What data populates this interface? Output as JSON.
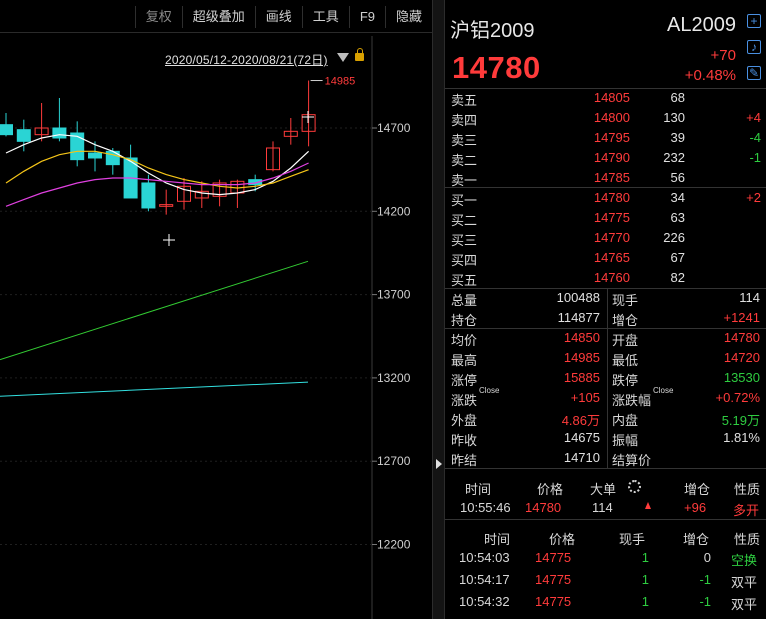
{
  "toolbar": {
    "buttons": [
      "复权",
      "超级叠加",
      "画线",
      "工具",
      "F9",
      "隐藏"
    ]
  },
  "chart": {
    "range_label": "2020/05/12-2020/08/21(72日)",
    "last_high_label": "14985",
    "y_ticks": [
      "14700",
      "14200",
      "13700",
      "13200",
      "12700",
      "12200"
    ],
    "colors": {
      "up": "#ff3b3b",
      "down": "#2ad4d4",
      "ma5": "#ffffff",
      "ma10": "#f5c518",
      "ma20": "#e040e0",
      "ma60": "#33cc33",
      "ma120": "#33e0e0"
    }
  },
  "chart_data": {
    "type": "candlestick",
    "title": "",
    "ylabel": "",
    "ylim": [
      12100,
      15050
    ],
    "series": [
      {
        "name": "",
        "ohlc": [
          [
            14720,
            14790,
            14650,
            14660
          ],
          [
            14690,
            14750,
            14560,
            14620
          ],
          [
            14660,
            14850,
            14620,
            14700
          ],
          [
            14700,
            14880,
            14620,
            14640
          ],
          [
            14670,
            14740,
            14470,
            14510
          ],
          [
            14550,
            14620,
            14440,
            14520
          ],
          [
            14560,
            14580,
            14420,
            14480
          ],
          [
            14520,
            14600,
            14280,
            14280
          ],
          [
            14370,
            14420,
            14200,
            14220
          ],
          [
            14230,
            14330,
            14180,
            14240
          ],
          [
            14260,
            14400,
            14210,
            14350
          ],
          [
            14280,
            14380,
            14220,
            14320
          ],
          [
            14290,
            14390,
            14230,
            14370
          ],
          [
            14310,
            14390,
            14220,
            14380
          ],
          [
            14390,
            14420,
            14320,
            14360
          ],
          [
            14450,
            14620,
            14440,
            14580
          ],
          [
            14650,
            14760,
            14600,
            14680
          ],
          [
            14680,
            14985,
            14590,
            14780
          ]
        ]
      },
      {
        "name": "",
        "values": [
          14550,
          14600,
          14640,
          14660,
          14650,
          14600,
          14560,
          14500,
          14430,
          14370,
          14330,
          14310,
          14300,
          14310,
          14330,
          14380,
          14460,
          14560
        ]
      },
      {
        "name": "",
        "values": [
          14370,
          14440,
          14500,
          14540,
          14560,
          14560,
          14540,
          14510,
          14460,
          14420,
          14390,
          14370,
          14350,
          14340,
          14350,
          14370,
          14410,
          14450
        ]
      },
      {
        "name": "",
        "values": [
          14230,
          14270,
          14310,
          14340,
          14370,
          14390,
          14400,
          14400,
          14390,
          14380,
          14370,
          14360,
          14360,
          14360,
          14370,
          14400,
          14440,
          14490
        ]
      },
      {
        "name": "",
        "x": [
          0,
          308
        ],
        "values": [
          13310,
          13900
        ]
      },
      {
        "name": "",
        "x": [
          0,
          308
        ],
        "values": [
          13090,
          13175
        ]
      }
    ]
  },
  "panel": {
    "contract_name": "沪铝2009",
    "contract_code": "AL2009",
    "last_price": "14780",
    "change": "+70",
    "change_pct": "+0.48%",
    "icons": [
      "add-icon",
      "bell-icon",
      "edit-icon"
    ],
    "orderbook": {
      "asks": [
        {
          "label": "卖五",
          "price": "14805",
          "vol": "68",
          "chg": "",
          "chg_dir": ""
        },
        {
          "label": "卖四",
          "price": "14800",
          "vol": "130",
          "chg": "+4",
          "chg_dir": "up"
        },
        {
          "label": "卖三",
          "price": "14795",
          "vol": "39",
          "chg": "-4",
          "chg_dir": "down"
        },
        {
          "label": "卖二",
          "price": "14790",
          "vol": "232",
          "chg": "-1",
          "chg_dir": "down"
        },
        {
          "label": "卖一",
          "price": "14785",
          "vol": "56",
          "chg": "",
          "chg_dir": ""
        }
      ],
      "bids": [
        {
          "label": "买一",
          "price": "14780",
          "vol": "34",
          "chg": "+2",
          "chg_dir": "up"
        },
        {
          "label": "买二",
          "price": "14775",
          "vol": "63",
          "chg": "",
          "chg_dir": ""
        },
        {
          "label": "买三",
          "price": "14770",
          "vol": "226",
          "chg": "",
          "chg_dir": ""
        },
        {
          "label": "买四",
          "price": "14765",
          "vol": "67",
          "chg": "",
          "chg_dir": ""
        },
        {
          "label": "买五",
          "price": "14760",
          "vol": "82",
          "chg": "",
          "chg_dir": ""
        }
      ]
    },
    "stats_a": [
      {
        "l1": "总量",
        "v1": "100488",
        "c1": "",
        "l2": "现手",
        "v2": "114",
        "c2": ""
      },
      {
        "l1": "持仓",
        "v1": "114877",
        "c1": "",
        "l2": "增仓",
        "v2": "+1241",
        "c2": "red"
      }
    ],
    "stats_b": [
      {
        "l1": "均价",
        "v1": "14850",
        "c1": "red",
        "l2": "开盘",
        "v2": "14780",
        "c2": "red"
      },
      {
        "l1": "最高",
        "v1": "14985",
        "c1": "red",
        "l2": "最低",
        "v2": "14720",
        "c2": "red"
      },
      {
        "l1": "涨停",
        "v1": "15885",
        "c1": "red",
        "l2": "跌停",
        "v2": "13530",
        "c2": "green"
      },
      {
        "l1": "涨跌",
        "sup1": "Close",
        "v1": "+105",
        "c1": "red",
        "l2": "涨跌幅",
        "sup2": "Close",
        "v2": "+0.72%",
        "c2": "red"
      },
      {
        "l1": "外盘",
        "v1": "4.86万",
        "c1": "red",
        "l2": "内盘",
        "v2": "5.19万",
        "c2": "green"
      },
      {
        "l1": "昨收",
        "v1": "14675",
        "c1": "",
        "l2": "振幅",
        "v2": "1.81%",
        "c2": ""
      },
      {
        "l1": "昨结",
        "v1": "14710",
        "c1": "",
        "l2": "结算价",
        "v2": "",
        "c2": ""
      }
    ],
    "latest": {
      "headers": [
        "时间",
        "价格",
        "大单",
        "增仓",
        "性质"
      ],
      "time": "10:55:46",
      "price": "14780",
      "size": "114",
      "oi_chg": "+96",
      "nature": "多开"
    },
    "ticks": {
      "headers": [
        "时间",
        "价格",
        "现手",
        "增仓",
        "性质"
      ],
      "rows": [
        {
          "time": "10:54:03",
          "price": "14775",
          "vol": "1",
          "oi": "0",
          "oi_dir": "",
          "nature": "空换",
          "nature_dir": "green"
        },
        {
          "time": "10:54:17",
          "price": "14775",
          "vol": "1",
          "oi": "-1",
          "oi_dir": "green",
          "nature": "双平",
          "nature_dir": ""
        },
        {
          "time": "10:54:32",
          "price": "14775",
          "vol": "1",
          "oi": "-1",
          "oi_dir": "green",
          "nature": "双平",
          "nature_dir": ""
        }
      ]
    }
  }
}
